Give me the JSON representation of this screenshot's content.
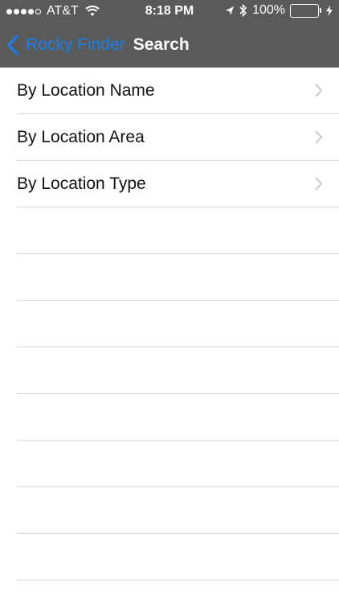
{
  "status_bar": {
    "carrier": "AT&T",
    "time": "8:18 PM",
    "battery": "100%",
    "battery_color": "#4cd964"
  },
  "nav": {
    "back_label": "Rocky Finder",
    "title": "Search",
    "back_icon": "chevron-left-icon",
    "accent_color": "#1a80e8",
    "bar_color": "#5a5a5a"
  },
  "rows": [
    {
      "label": "By Location Name"
    },
    {
      "label": "By Location Area"
    },
    {
      "label": "By Location Type"
    }
  ]
}
